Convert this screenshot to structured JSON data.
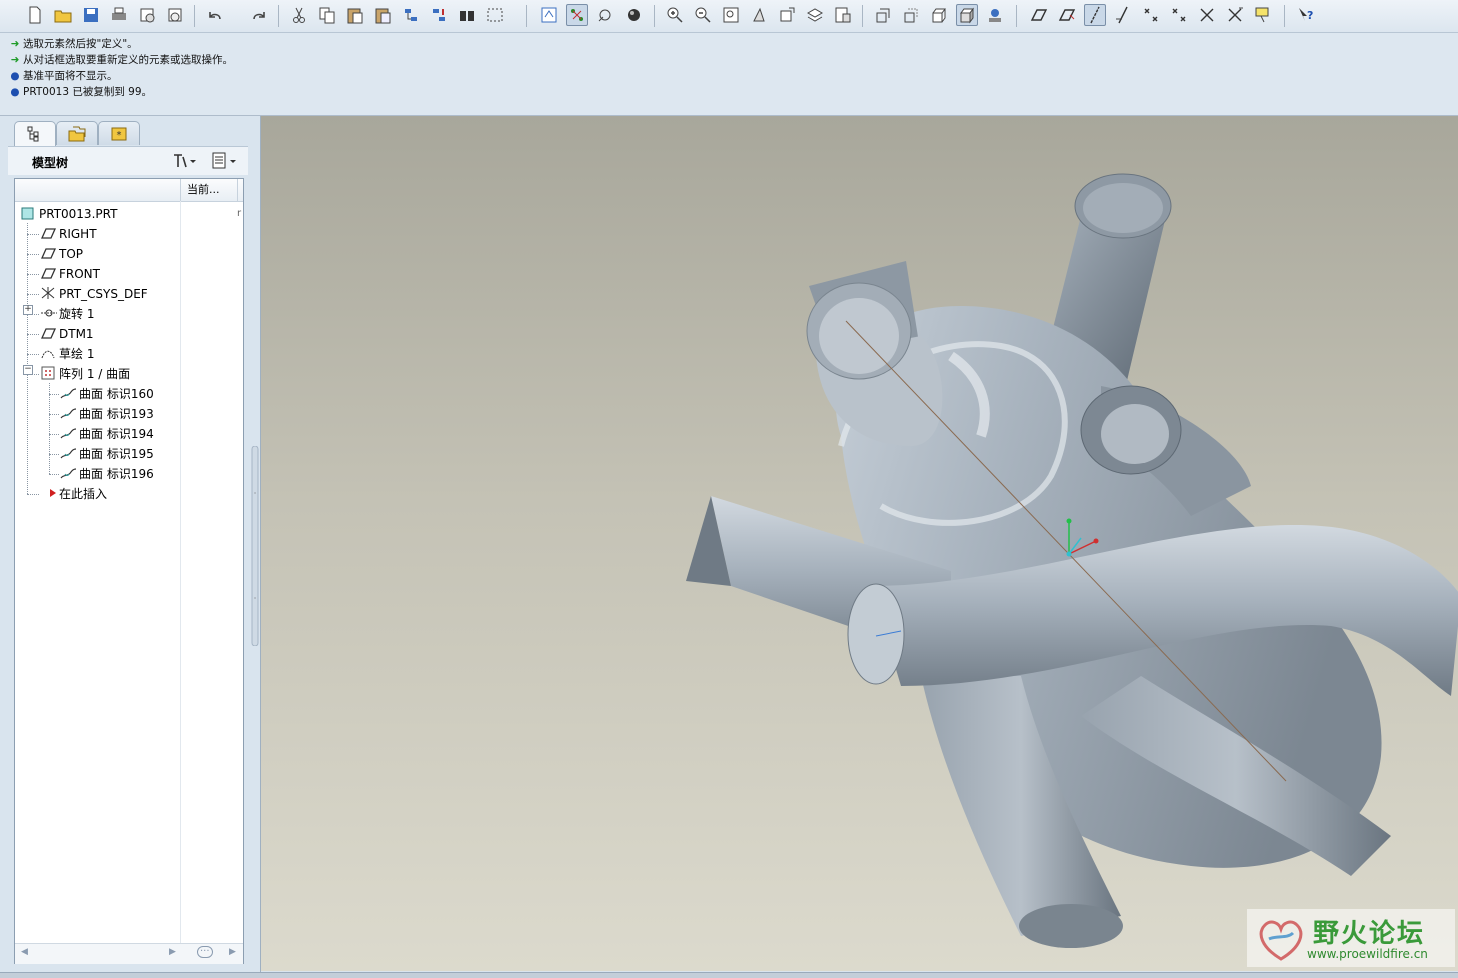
{
  "toolbar": {
    "buttons": [
      {
        "name": "new-icon"
      },
      {
        "name": "open-icon"
      },
      {
        "name": "save-icon"
      },
      {
        "name": "print-icon"
      },
      {
        "name": "email-icon"
      },
      {
        "name": "email-link-icon"
      },
      {
        "name": "undo-icon"
      },
      {
        "name": "redo-icon"
      },
      {
        "name": "cut-icon"
      },
      {
        "name": "copy-icon"
      },
      {
        "name": "paste-icon"
      },
      {
        "name": "paste-special-icon"
      },
      {
        "name": "regenerate-icon"
      },
      {
        "name": "regen-manager-icon"
      },
      {
        "name": "find-icon"
      },
      {
        "name": "select-box-icon"
      },
      {
        "name": "redraw-icon"
      },
      {
        "name": "spin-center-icon"
      },
      {
        "name": "orient-mode-icon"
      },
      {
        "name": "appearance-icon"
      },
      {
        "name": "zoom-in-icon"
      },
      {
        "name": "zoom-out-icon"
      },
      {
        "name": "refit-icon"
      },
      {
        "name": "reorient-icon"
      },
      {
        "name": "saved-views-icon"
      },
      {
        "name": "layers-icon"
      },
      {
        "name": "view-manager-icon"
      },
      {
        "name": "wireframe-icon"
      },
      {
        "name": "hidden-line-icon"
      },
      {
        "name": "no-hidden-icon"
      },
      {
        "name": "shading-icon"
      },
      {
        "name": "enhanced-realism-icon"
      },
      {
        "name": "datum-plane-icon"
      },
      {
        "name": "datum-plane-tag-icon"
      },
      {
        "name": "datum-axis-icon"
      },
      {
        "name": "datum-axis-tag-icon"
      },
      {
        "name": "datum-point-icon"
      },
      {
        "name": "datum-point-tag-icon"
      },
      {
        "name": "csys-icon"
      },
      {
        "name": "csys-tag-icon"
      },
      {
        "name": "annotation-display-icon"
      },
      {
        "name": "context-help-icon"
      }
    ]
  },
  "messages": [
    {
      "type": "arrow",
      "text": "选取元素然后按\"定义\"。"
    },
    {
      "type": "arrow",
      "text": "从对话框选取要重新定义的元素或选取操作。"
    },
    {
      "type": "dot",
      "text": "基准平面将不显示。"
    },
    {
      "type": "dot",
      "text": "PRT0013 已被复制到 99。"
    }
  ],
  "navigator": {
    "title": "模型树",
    "column_current": "当前...",
    "column_glyph": "r",
    "nodes": [
      {
        "label": "PRT0013.PRT",
        "icon": "part-icon"
      },
      {
        "label": "RIGHT",
        "icon": "datum-plane-icon"
      },
      {
        "label": "TOP",
        "icon": "datum-plane-icon"
      },
      {
        "label": "FRONT",
        "icon": "datum-plane-icon"
      },
      {
        "label": "PRT_CSYS_DEF",
        "icon": "csys-icon"
      },
      {
        "label": "旋转 1",
        "icon": "revolve-icon"
      },
      {
        "label": "DTM1",
        "icon": "datum-plane-icon"
      },
      {
        "label": "草绘 1",
        "icon": "sketch-icon"
      },
      {
        "label": "阵列 1 / 曲面",
        "icon": "pattern-icon"
      },
      {
        "label": "曲面 标识160",
        "icon": "surface-icon"
      },
      {
        "label": "曲面 标识193",
        "icon": "surface-icon"
      },
      {
        "label": "曲面 标识194",
        "icon": "surface-icon"
      },
      {
        "label": "曲面 标识195",
        "icon": "surface-icon"
      },
      {
        "label": "曲面 标识196",
        "icon": "surface-icon"
      },
      {
        "label": "在此插入",
        "icon": "insert-here-icon"
      }
    ]
  },
  "colors": {
    "model_surface": "#9aa6b2",
    "model_shadow": "#5f6a75",
    "model_highlight": "#d6dde4",
    "axis_line": "#8a6a50",
    "background_top": "#a8a79b",
    "background_bottom": "#dcdacd"
  },
  "watermark": {
    "title": "野火论坛",
    "url": "www.proewildfire.cn"
  }
}
